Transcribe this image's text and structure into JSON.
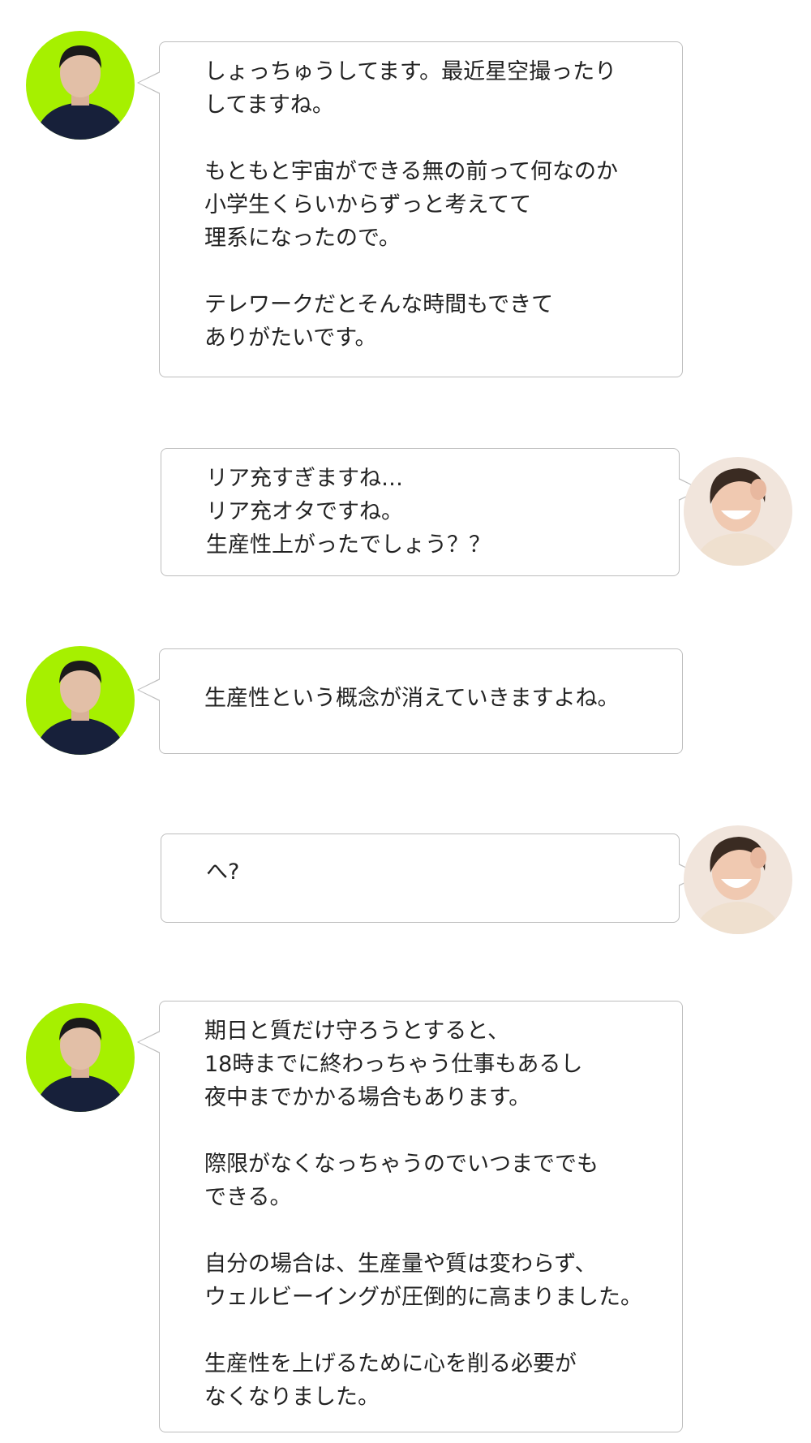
{
  "colors": {
    "avatar_male_bg": "#a6f000",
    "avatar_female_bg": "#f1e5dc",
    "bubble_border": "#bdbdbd"
  },
  "avatars": {
    "male": "man-avatar-photo",
    "female": "woman-avatar-photo"
  },
  "messages": [
    {
      "speaker": "male",
      "text": "しょっちゅうしてます。最近星空撮ったり\nしてますね。\n\nもともと宇宙ができる無の前って何なのか\n小学生くらいからずっと考えてて\n理系になったので。\n\nテレワークだとそんな時間もできて\nありがたいです。"
    },
    {
      "speaker": "female",
      "text": "リア充すぎますね…\nリア充オタですね。\n生産性上がったでしょう？？"
    },
    {
      "speaker": "male",
      "text": "生産性という概念が消えていきますよね。"
    },
    {
      "speaker": "female",
      "text": "へ?"
    },
    {
      "speaker": "male",
      "text": "期日と質だけ守ろうとすると、\n18時までに終わっちゃう仕事もあるし\n夜中までかかる場合もあります。\n\n際限がなくなっちゃうのでいつまででも\nできる。\n\n自分の場合は、生産量や質は変わらず、\nウェルビーイングが圧倒的に高まりました。\n\n生産性を上げるために心を削る必要が\nなくなりました。"
    }
  ]
}
